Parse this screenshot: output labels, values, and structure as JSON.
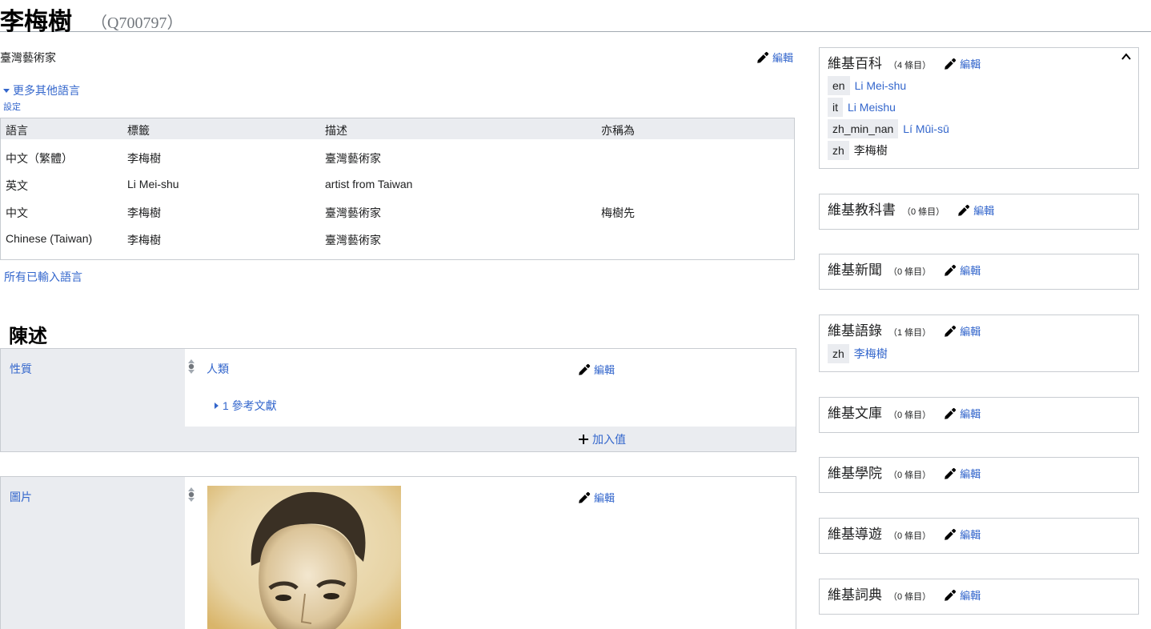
{
  "page": {
    "title": "李梅樹",
    "qid": "（Q700797）"
  },
  "header": {
    "description": "臺灣藝術家",
    "edit_label": "編輯",
    "more_languages": "更多其他語言",
    "settings": "設定",
    "all_languages": "所有已輸入語言"
  },
  "lang_table": {
    "columns": [
      "語言",
      "標籤",
      "描述",
      "亦稱為"
    ],
    "rows": [
      {
        "language": "中文（繁體）",
        "label": "李梅樹",
        "description": "臺灣藝術家",
        "aliases": ""
      },
      {
        "language": "英文",
        "label": "Li Mei-shu",
        "description": "artist from Taiwan",
        "aliases": ""
      },
      {
        "language": "中文",
        "label": "李梅樹",
        "description": "臺灣藝術家",
        "aliases": "梅樹先"
      },
      {
        "language": "Chinese (Taiwan)",
        "label": "李梅樹",
        "description": "臺灣藝術家",
        "aliases": ""
      }
    ]
  },
  "statements": {
    "section_title": "陳述",
    "items": [
      {
        "property": "性質",
        "value": "人類",
        "references": "1 參考文獻",
        "edit_label": "編輯",
        "add_value": "加入值"
      },
      {
        "property": "圖片",
        "edit_label": "編輯"
      }
    ]
  },
  "sitelinks": [
    {
      "name": "維基百科",
      "count": "（4 條目）",
      "edit": "編輯",
      "links": [
        {
          "code": "en",
          "title": "Li Mei-shu"
        },
        {
          "code": "it",
          "title": "Li Meishu"
        },
        {
          "code": "zh_min_nan",
          "title": "Lí Mûi-sū"
        },
        {
          "code": "zh",
          "title": "李梅樹"
        }
      ]
    },
    {
      "name": "維基教科書",
      "count": "（0 條目）",
      "edit": "編輯",
      "links": []
    },
    {
      "name": "維基新聞",
      "count": "（0 條目）",
      "edit": "編輯",
      "links": []
    },
    {
      "name": "維基語錄",
      "count": "（1 條目）",
      "edit": "編輯",
      "links": [
        {
          "code": "zh",
          "title": "李梅樹"
        }
      ]
    },
    {
      "name": "維基文庫",
      "count": "（0 條目）",
      "edit": "編輯",
      "links": []
    },
    {
      "name": "維基學院",
      "count": "（0 條目）",
      "edit": "編輯",
      "links": []
    },
    {
      "name": "維基導遊",
      "count": "（0 條目）",
      "edit": "編輯",
      "links": []
    },
    {
      "name": "維基詞典",
      "count": "（0 條目）",
      "edit": "編輯",
      "links": []
    }
  ],
  "icons": {
    "edit": "pencil-icon",
    "add": "plus-icon",
    "rank": "normal-rank-icon",
    "collapse": "chevron-up-icon",
    "expand": "triangle-down-icon",
    "references_toggle": "triangle-right-icon"
  },
  "colors": {
    "link": "#3366cc",
    "panel_bg": "#eaecf0",
    "border": "#c8ccd1"
  }
}
